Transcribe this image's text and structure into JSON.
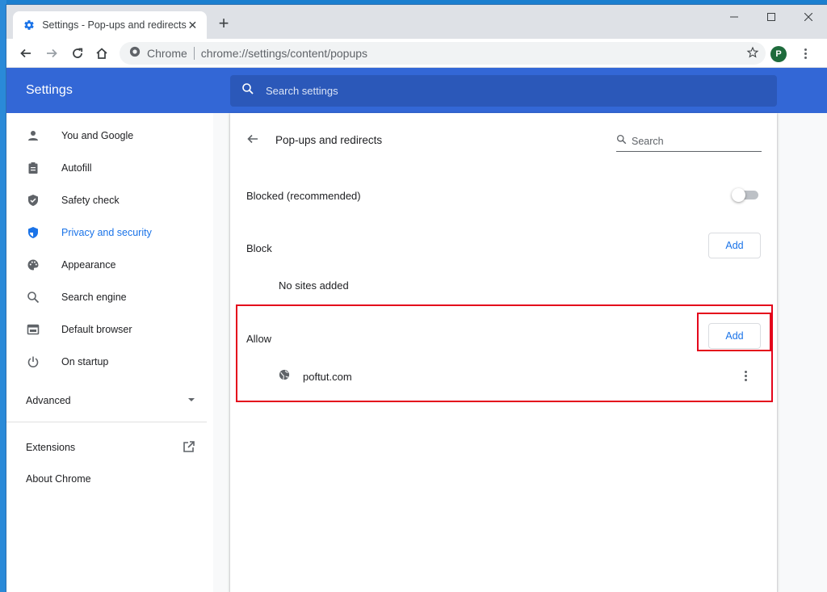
{
  "browser": {
    "tab_title": "Settings - Pop-ups and redirects",
    "new_tab": "+",
    "omnibox_site": "Chrome",
    "omnibox_url": "chrome://settings/content/popups",
    "profile_initial": "P"
  },
  "header": {
    "title": "Settings",
    "search_placeholder": "Search settings"
  },
  "sidebar": {
    "items": [
      {
        "label": "You and Google",
        "icon": "person-icon"
      },
      {
        "label": "Autofill",
        "icon": "clipboard-icon"
      },
      {
        "label": "Safety check",
        "icon": "shield-check-icon"
      },
      {
        "label": "Privacy and security",
        "icon": "shield-icon",
        "active": true
      },
      {
        "label": "Appearance",
        "icon": "palette-icon"
      },
      {
        "label": "Search engine",
        "icon": "search-icon"
      },
      {
        "label": "Default browser",
        "icon": "browser-icon"
      },
      {
        "label": "On startup",
        "icon": "power-icon"
      }
    ],
    "advanced": "Advanced",
    "extensions": "Extensions",
    "about": "About Chrome"
  },
  "page": {
    "title": "Pop-ups and redirects",
    "search_placeholder": "Search",
    "blocked_label": "Blocked (recommended)",
    "blocked_enabled": false,
    "block_section": "Block",
    "block_add": "Add",
    "no_sites": "No sites added",
    "allow_section": "Allow",
    "allow_add": "Add",
    "allowed_sites": [
      {
        "url": "poftut.com"
      }
    ]
  },
  "colors": {
    "header_blue": "#3367d6",
    "accent": "#1a73e8",
    "highlight": "#e4051b"
  }
}
